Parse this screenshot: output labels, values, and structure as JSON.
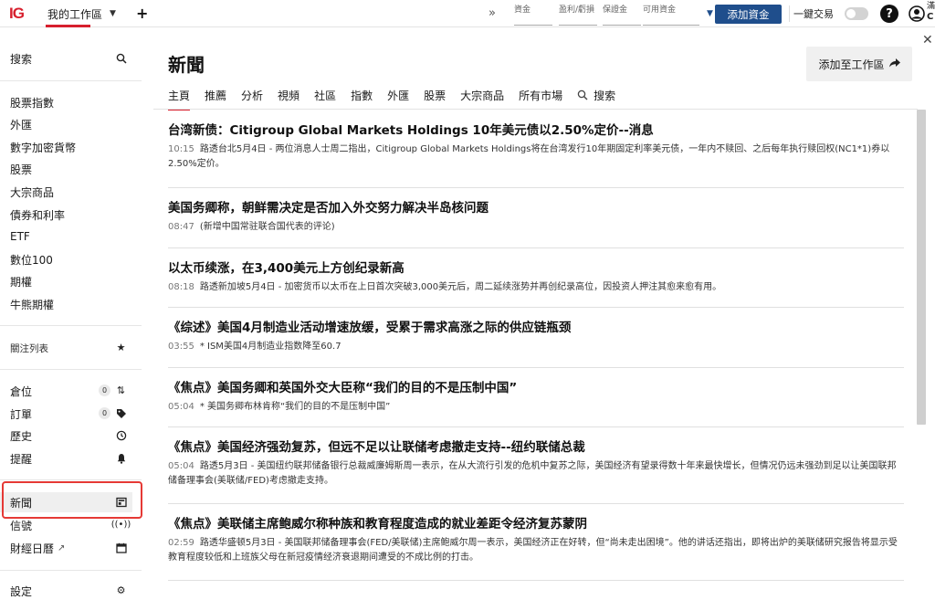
{
  "topbar": {
    "logo": "IG",
    "workspace_tab": "我的工作區",
    "add_tab": "+",
    "expand": "»",
    "metrics": [
      "資金",
      "盈利/虧損",
      "保證金",
      "可用資金"
    ],
    "add_funds": "添加資金",
    "one_click": "一鍵交易",
    "help": "?",
    "user_initial_top": "滿",
    "user_initial_bottom": "C"
  },
  "sidebar": {
    "search": "搜索",
    "markets": [
      "股票指數",
      "外匯",
      "數字加密貨幣",
      "股票",
      "大宗商品",
      "債券和利率",
      "ETF",
      "數位100",
      "期權",
      "牛熊期權"
    ],
    "watchlist": "關注列表",
    "positions": "倉位",
    "positions_count": "0",
    "orders": "訂單",
    "orders_count": "0",
    "history": "歷史",
    "alerts": "提醒",
    "news": "新聞",
    "signals": "信號",
    "calendar": "財經日曆",
    "settings": "設定"
  },
  "main": {
    "title": "新聞",
    "add_to_workspace": "添加至工作區",
    "tabs": [
      "主頁",
      "推薦",
      "分析",
      "視頻",
      "社區",
      "指數",
      "外匯",
      "股票",
      "大宗商品",
      "所有市場"
    ],
    "search_tab": "搜索"
  },
  "articles": [
    {
      "headline": "台湾新债：Citigroup Global Markets Holdings 10年美元债以2.50%定价--消息",
      "time": "10:15",
      "summary": "路透台北5月4日 - 两位消息人士周二指出，Citigroup Global Markets Holdings将在台湾发行10年期固定利率美元债，一年内不赎回、之后每年执行赎回权(NC1*1)券以2.50%定价。"
    },
    {
      "headline": "美国务卿称，朝鲜需决定是否加入外交努力解决半岛核问题",
      "time": "08:47",
      "summary": "(新增中国常驻联合国代表的评论)"
    },
    {
      "headline": "以太币续涨，在3,400美元上方创纪录新高",
      "time": "08:18",
      "summary": "路透新加坡5月4日 - 加密货币以太币在上日首次突破3,000美元后，周二延续涨势并再创纪录高位，因投资人押注其愈来愈有用。"
    },
    {
      "headline": "《综述》美国4月制造业活动增速放缓，受累于需求高涨之际的供应链瓶颈",
      "time": "03:55",
      "summary": "* ISM美国4月制造业指数降至60.7"
    },
    {
      "headline": "《焦点》美国务卿和英国外交大臣称“我们的目的不是压制中国”",
      "time": "05:04",
      "summary": "* 美国务卿布林肯称“我们的目的不是压制中国”"
    },
    {
      "headline": "《焦点》美国经济强劲复苏，但远不足以让联储考虑撤走支持--纽约联储总裁",
      "time": "05:04",
      "summary": "路透5月3日 - 美国纽约联邦储备银行总裁威廉姆斯周一表示，在从大流行引发的危机中复苏之际，美国经济有望录得数十年来最快增长，但情况仍远未强劲到足以让美国联邦储备理事会(美联储/FED)考虑撤走支持。"
    },
    {
      "headline": "《焦点》美联储主席鲍威尔称种族和教育程度造成的就业差距令经济复苏蒙阴",
      "time": "02:59",
      "summary": "路透华盛顿5月3日 - 美国联邦储备理事会(FED/美联储)主席鲍威尔周一表示，美国经济正在好转，但“尚未走出困境”。他的讲话还指出，即将出炉的美联储研究报告将显示受教育程度较低和上班族父母在新冠疫情经济衰退期间遭受的不成比例的打击。"
    }
  ]
}
